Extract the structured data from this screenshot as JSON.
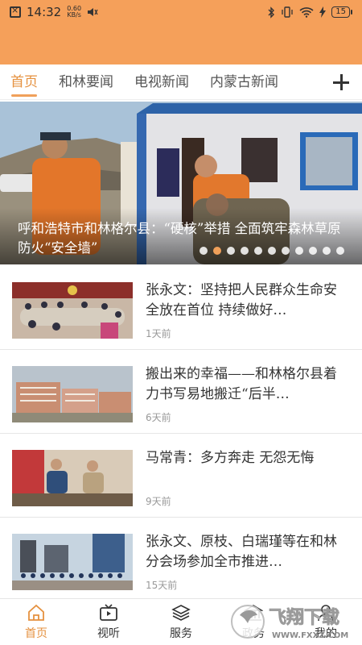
{
  "status": {
    "time": "14:32",
    "net_speed_value": "0.60",
    "net_speed_unit": "KB/s",
    "battery": "15"
  },
  "tabs": [
    {
      "label": "首页",
      "active": true
    },
    {
      "label": "和林要闻",
      "active": false
    },
    {
      "label": "电视新闻",
      "active": false
    },
    {
      "label": "内蒙古新闻",
      "active": false
    }
  ],
  "banner": {
    "title": "呼和浩特市和林格尔县：“硬核”举措 全面筑牢森林草原防火“安全墙”",
    "dot_count": 11,
    "active_dot": 1
  },
  "news": [
    {
      "title": "张永文：坚持把人民群众生命安全放在首位 持续做好…",
      "time": "1天前",
      "thumb": "meeting-photo"
    },
    {
      "title": "搬出来的幸福——和林格尔县着力书写易地搬迁“后半…",
      "time": "6天前",
      "thumb": "apartment-buildings-photo"
    },
    {
      "title": "马常青：多方奔走 无怨无悔",
      "time": "9天前",
      "thumb": "home-visit-photo"
    },
    {
      "title": "张永文、原枝、白瑞瑾等在和林分会场参加全市推进…",
      "time": "15天前",
      "thumb": "outdoor-rally-photo"
    }
  ],
  "bottom_nav": [
    {
      "label": "首页",
      "icon": "home-icon",
      "active": true
    },
    {
      "label": "视听",
      "icon": "tv-icon",
      "active": false
    },
    {
      "label": "服务",
      "icon": "layers-icon",
      "active": false
    },
    {
      "label": "政务",
      "icon": "government-icon",
      "active": false
    },
    {
      "label": "我的",
      "icon": "user-icon",
      "active": false
    }
  ],
  "watermark": {
    "brand": "飞翔下载",
    "url": "WWW.FXXZ.COM"
  },
  "colors": {
    "accent": "#e5913f",
    "header": "#f5a05a"
  }
}
